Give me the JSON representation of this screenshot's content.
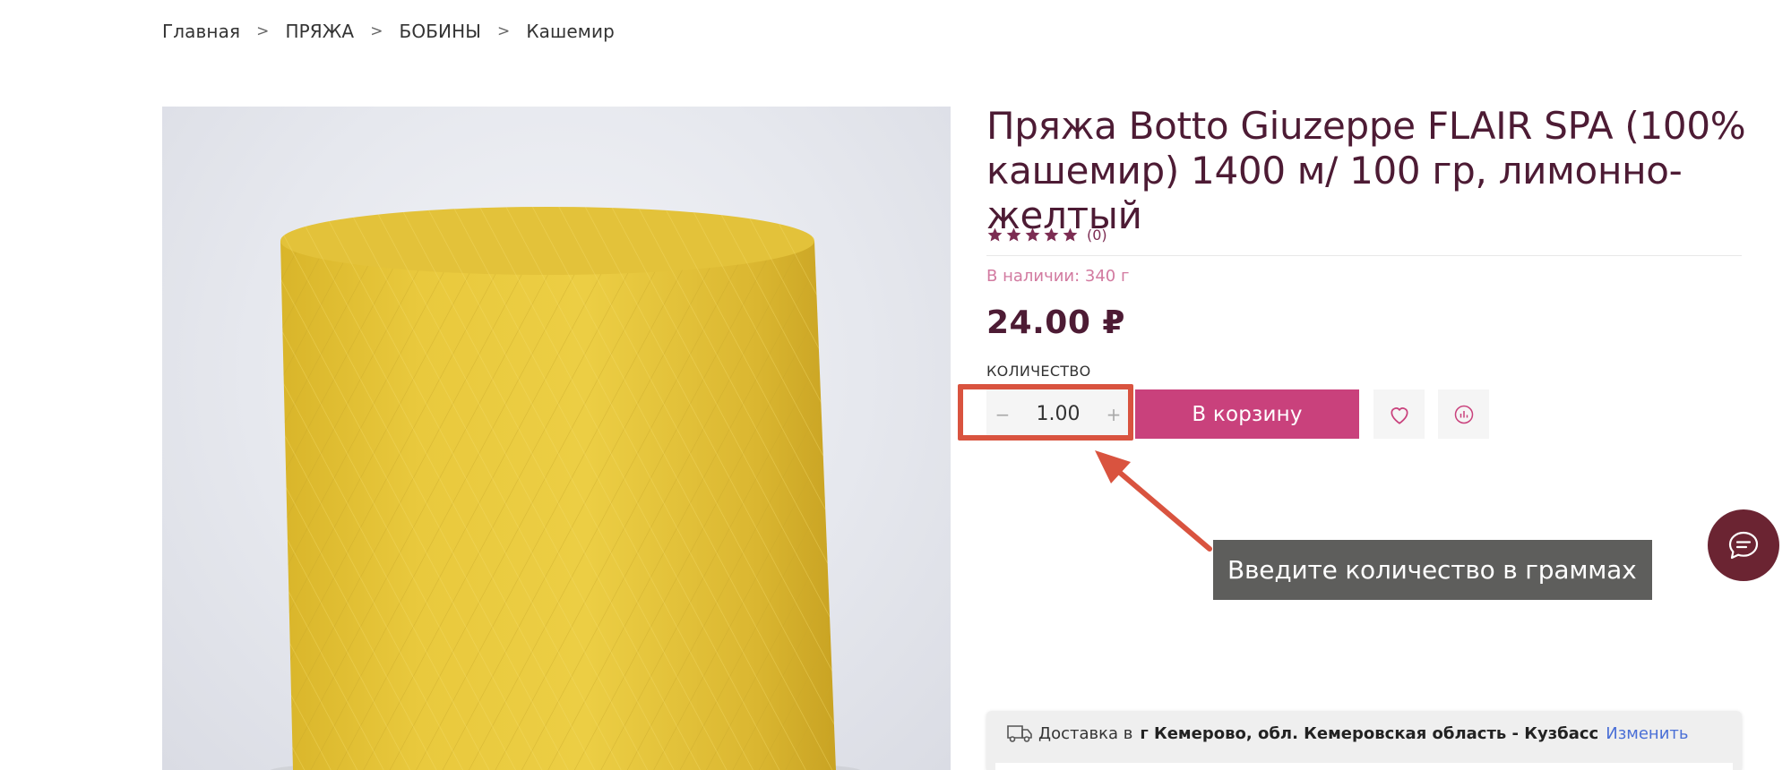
{
  "breadcrumb": {
    "items": [
      "Главная",
      "ПРЯЖА",
      "БОБИНЫ",
      "Кашемир"
    ],
    "separator": ">"
  },
  "product": {
    "title": "Пряжа Botto Giuzeppe FLAIR SPA (100% кашемир) 1400 м/ 100 гр, лимонно-желтый",
    "rating_count": "(0)",
    "rating": 0,
    "stock": "В наличии: 340 г",
    "price": "24.00 ₽",
    "yarn_color": "#e8c53a",
    "image_alt": "yarn-bobbin"
  },
  "quantity": {
    "label": "КОЛИЧЕСТВО",
    "value": "1.00",
    "minus": "−",
    "plus": "+"
  },
  "actions": {
    "cart_label": "В корзину",
    "favorite_icon": "heart-icon",
    "compare_icon": "chart-icon"
  },
  "annotation": {
    "text": "Введите количество в граммах",
    "highlight_color": "#d9533f"
  },
  "delivery": {
    "prefix": "Доставка в",
    "location": "г Кемерово, обл. Кемеровская область - Кузбасс",
    "change_label": "Изменить"
  },
  "colors": {
    "accent": "#c9417c",
    "title": "#4d1b34",
    "chat": "#6b2432"
  }
}
